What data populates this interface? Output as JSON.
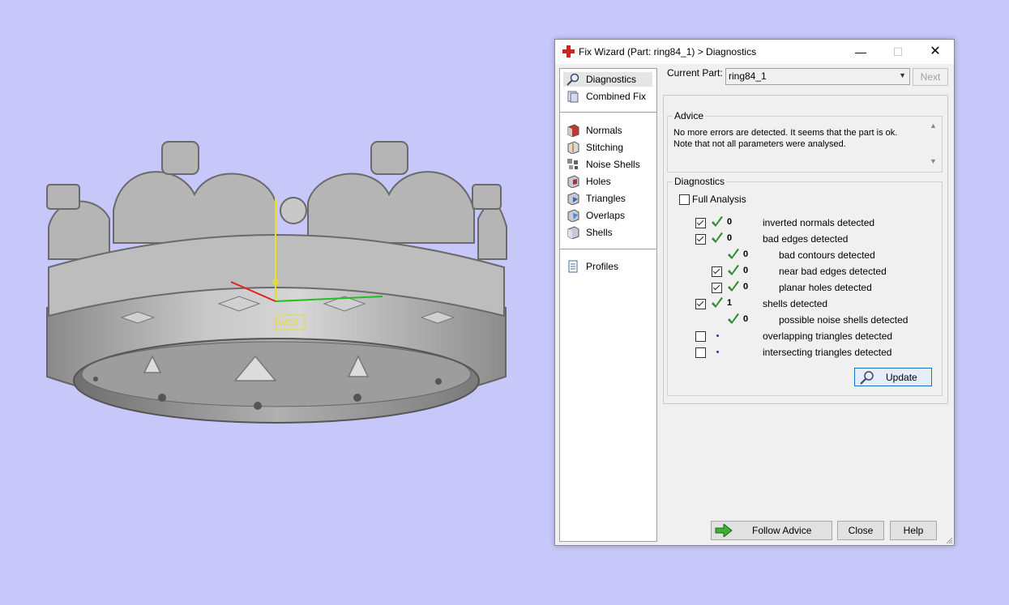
{
  "viewport": {
    "axis_label": "WCS",
    "y_axis_label": "Y",
    "background": "#c7c7fa"
  },
  "dialog": {
    "title": "Fix Wizard (Part: ring84_1) > Diagnostics",
    "title_icon": "red-cross-icon",
    "controls": {
      "minimize": "—",
      "maximize": "☐",
      "close": "✕"
    }
  },
  "nav": {
    "group1": [
      {
        "label": "Diagnostics",
        "icon": "magnifier-icon",
        "selected": true
      },
      {
        "label": "Combined Fix",
        "icon": "layers-icon"
      }
    ],
    "group2": [
      {
        "label": "Normals",
        "icon": "normals-cube-icon"
      },
      {
        "label": "Stitching",
        "icon": "stitching-cube-icon"
      },
      {
        "label": "Noise Shells",
        "icon": "noise-shells-icon"
      },
      {
        "label": "Holes",
        "icon": "holes-cube-icon"
      },
      {
        "label": "Triangles",
        "icon": "triangles-cube-icon"
      },
      {
        "label": "Overlaps",
        "icon": "overlaps-cube-icon"
      },
      {
        "label": "Shells",
        "icon": "shells-cube-icon"
      }
    ],
    "group3": [
      {
        "label": "Profiles",
        "icon": "document-icon"
      }
    ]
  },
  "current_part": {
    "label": "Current Part:",
    "value": "ring84_1",
    "next_label": "Next"
  },
  "advice": {
    "label": "Advice",
    "text": "No more errors are detected. It seems that the part is ok. Note that not all parameters were analysed."
  },
  "diagnostics": {
    "label": "Diagnostics",
    "full_analysis_label": "Full Analysis",
    "rows": [
      {
        "checkbox": true,
        "checked": true,
        "status": "ok",
        "count": "0",
        "label": "inverted normals detected",
        "indent": 0
      },
      {
        "checkbox": true,
        "checked": true,
        "status": "ok",
        "count": "0",
        "label": "bad edges detected",
        "indent": 0
      },
      {
        "checkbox": false,
        "checked": false,
        "status": "ok",
        "count": "0",
        "label": "bad contours detected",
        "indent": 1
      },
      {
        "checkbox": true,
        "checked": true,
        "status": "ok",
        "count": "0",
        "label": "near bad edges detected",
        "indent": 1
      },
      {
        "checkbox": true,
        "checked": true,
        "status": "ok",
        "count": "0",
        "label": "planar holes detected",
        "indent": 1
      },
      {
        "checkbox": true,
        "checked": true,
        "status": "ok",
        "count": "1",
        "label": "shells detected",
        "indent": 0
      },
      {
        "checkbox": false,
        "checked": false,
        "status": "ok",
        "count": "0",
        "label": "possible noise shells detected",
        "indent": 1
      },
      {
        "checkbox": true,
        "checked": false,
        "status": "none",
        "count": "",
        "label": "overlapping triangles detected",
        "indent": 0
      },
      {
        "checkbox": true,
        "checked": false,
        "status": "none",
        "count": "",
        "label": "intersecting triangles detected",
        "indent": 0
      }
    ],
    "update_label": "Update"
  },
  "footer": {
    "follow_advice_label": "Follow Advice",
    "close_label": "Close",
    "help_label": "Help"
  },
  "colors": {
    "tick": "#2e8b2e",
    "accent": "#1e6cc4",
    "title_icon": "#d62020"
  }
}
